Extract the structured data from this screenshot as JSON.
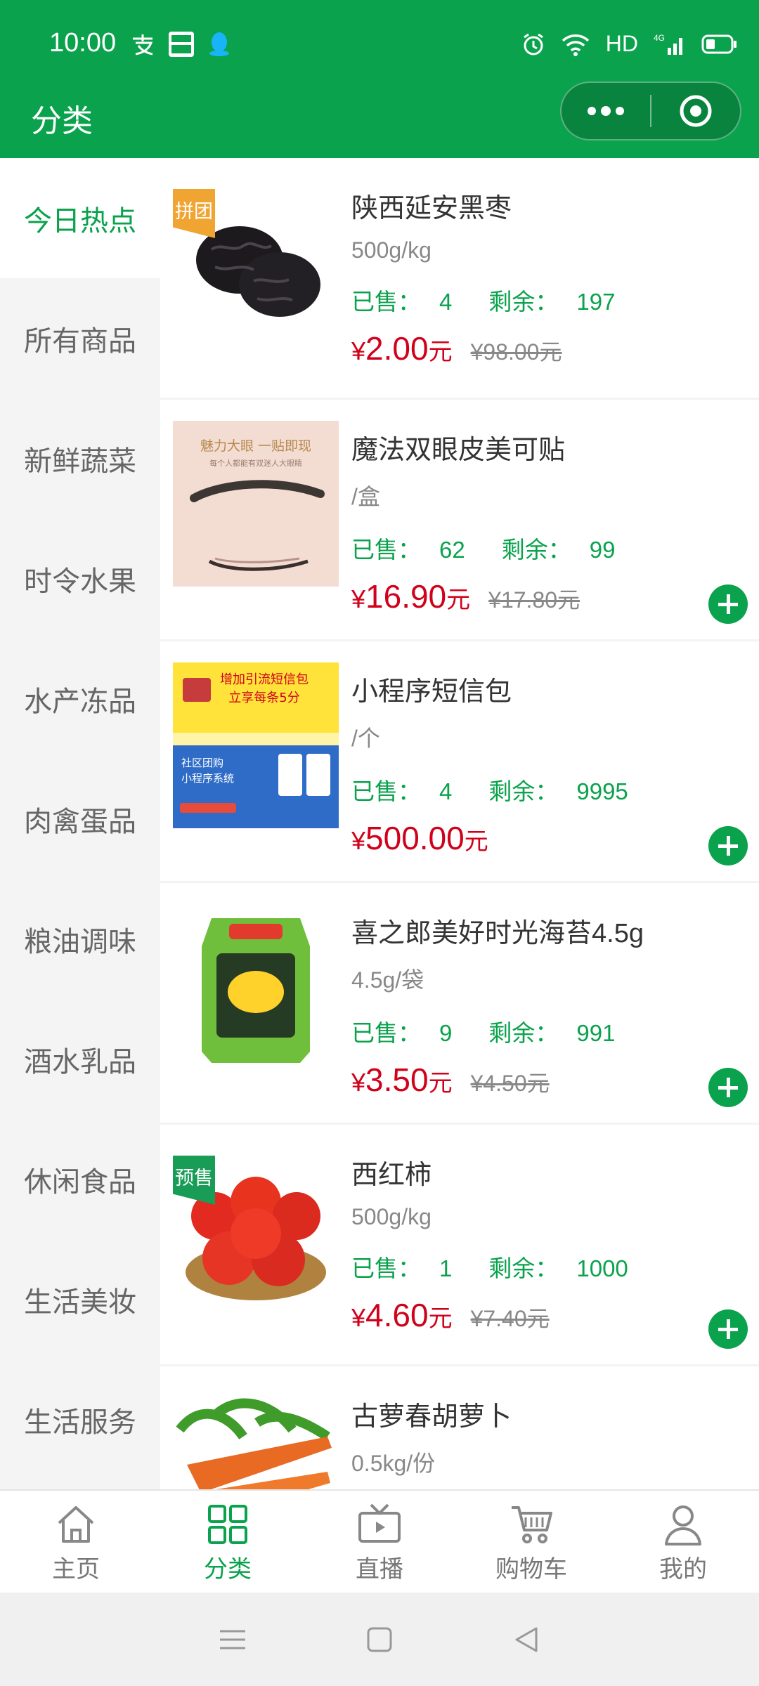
{
  "status": {
    "time": "10:00",
    "network": "HD",
    "signal": "4G"
  },
  "header": {
    "title": "分类",
    "more_icon": "more-dots-icon",
    "close_icon": "target-icon"
  },
  "sidebar": {
    "items": [
      {
        "label": "今日热点",
        "active": true
      },
      {
        "label": "所有商品"
      },
      {
        "label": "新鲜蔬菜"
      },
      {
        "label": "时令水果"
      },
      {
        "label": "水产冻品"
      },
      {
        "label": "肉禽蛋品"
      },
      {
        "label": "粮油调味"
      },
      {
        "label": "酒水乳品"
      },
      {
        "label": "休闲食品"
      },
      {
        "label": "生活美妆"
      },
      {
        "label": "生活服务"
      }
    ]
  },
  "products": [
    {
      "tag": "拼团",
      "name": "陕西延安黑枣",
      "unit": "500g/kg",
      "sold_label": "已售：",
      "sold": "4",
      "remain_label": "剩余：",
      "remain": "197",
      "yen": "¥",
      "price": "2.00",
      "yuan": "元",
      "old_price": "¥98.00元"
    },
    {
      "tag": "",
      "name": "魔法双眼皮美可贴",
      "unit": "/盒",
      "sold_label": "已售：",
      "sold": "62",
      "remain_label": "剩余：",
      "remain": "99",
      "yen": "¥",
      "price": "16.90",
      "yuan": "元",
      "old_price": "¥17.80元",
      "image_text_1": "魅力大眼 一贴即现",
      "image_text_2": "每个人都能有双迷人大眼睛"
    },
    {
      "tag": "",
      "name": "小程序短信包",
      "unit": "/个",
      "sold_label": "已售：",
      "sold": "4",
      "remain_label": "剩余：",
      "remain": "9995",
      "yen": "¥",
      "price": "500.00",
      "yuan": "元",
      "old_price": "",
      "image_text_1": "增加引流短信包",
      "image_text_2": "立享每条5分",
      "image_text_3": "社区团购",
      "image_text_4": "小程序系统"
    },
    {
      "tag": "",
      "name": "喜之郎美好时光海苔4.5g",
      "unit": "4.5g/袋",
      "sold_label": "已售：",
      "sold": "9",
      "remain_label": "剩余：",
      "remain": "991",
      "yen": "¥",
      "price": "3.50",
      "yuan": "元",
      "old_price": "¥4.50元"
    },
    {
      "tag": "预售",
      "name": "西红柿",
      "unit": "500g/kg",
      "sold_label": "已售：",
      "sold": "1",
      "remain_label": "剩余：",
      "remain": "1000",
      "yen": "¥",
      "price": "4.60",
      "yuan": "元",
      "old_price": "¥7.40元"
    },
    {
      "tag": "",
      "name": "古萝春胡萝卜",
      "unit": "0.5kg/份"
    }
  ],
  "tabbar": {
    "items": [
      {
        "label": "主页",
        "icon": "home-icon"
      },
      {
        "label": "分类",
        "icon": "category-grid-icon",
        "active": true
      },
      {
        "label": "直播",
        "icon": "live-tv-icon"
      },
      {
        "label": "购物车",
        "icon": "cart-icon"
      },
      {
        "label": "我的",
        "icon": "user-icon"
      }
    ]
  },
  "colors": {
    "brand": "#0aa24c",
    "price": "#d0021b"
  }
}
